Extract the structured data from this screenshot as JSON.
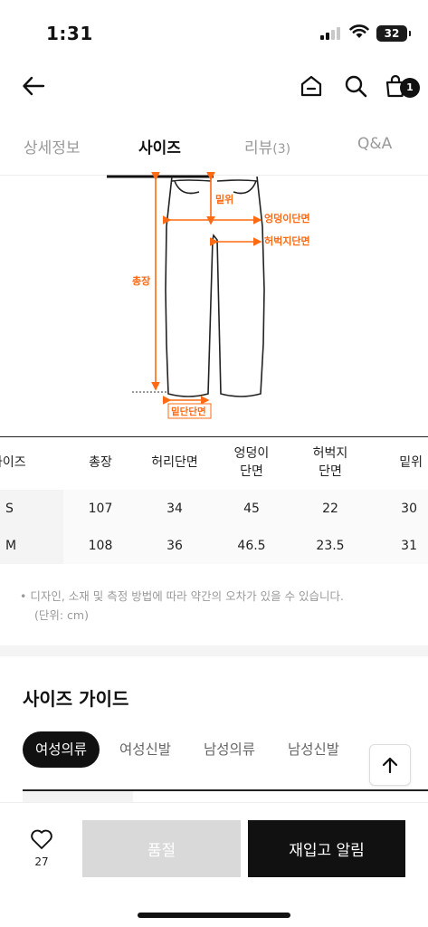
{
  "status_bar": {
    "time": "1:31",
    "battery": "32"
  },
  "header": {
    "cart_count": "1",
    "icons": [
      "back-arrow-icon",
      "home-icon",
      "search-icon",
      "shopping-bag-icon"
    ]
  },
  "tabs": [
    {
      "label": "상세정보",
      "count": ""
    },
    {
      "label": "사이즈",
      "count": ""
    },
    {
      "label": "리뷰",
      "count": "(3)"
    },
    {
      "label": "Q&A",
      "count": ""
    }
  ],
  "diagram": {
    "labels": {
      "rise": "밑위",
      "hip": "엉덩이단면",
      "thigh": "허벅지단면",
      "length": "총장",
      "hem": "밑단단면"
    },
    "accent_color": "#ff6a13"
  },
  "size_table": {
    "headers": [
      "사이즈",
      "총장",
      "허리단면",
      "엉덩이\n단면",
      "허벅지\n단면",
      "밑위"
    ],
    "rows": [
      [
        "S",
        "107",
        "34",
        "45",
        "22",
        "30"
      ],
      [
        "M",
        "108",
        "36",
        "46.5",
        "23.5",
        "31"
      ]
    ]
  },
  "note": {
    "line1": "• 디자인, 소재 및 측정 방법에 따라 약간의 오차가 있을 수 있습니다.",
    "line2": "(단위: cm)"
  },
  "size_guide": {
    "title": "사이즈 가이드",
    "tabs": [
      "여성의류",
      "여성신발",
      "남성의류",
      "남성신발"
    ]
  },
  "bottom_bar": {
    "like_count": "27",
    "soldout_label": "품절",
    "restock_label": "재입고 알림"
  }
}
